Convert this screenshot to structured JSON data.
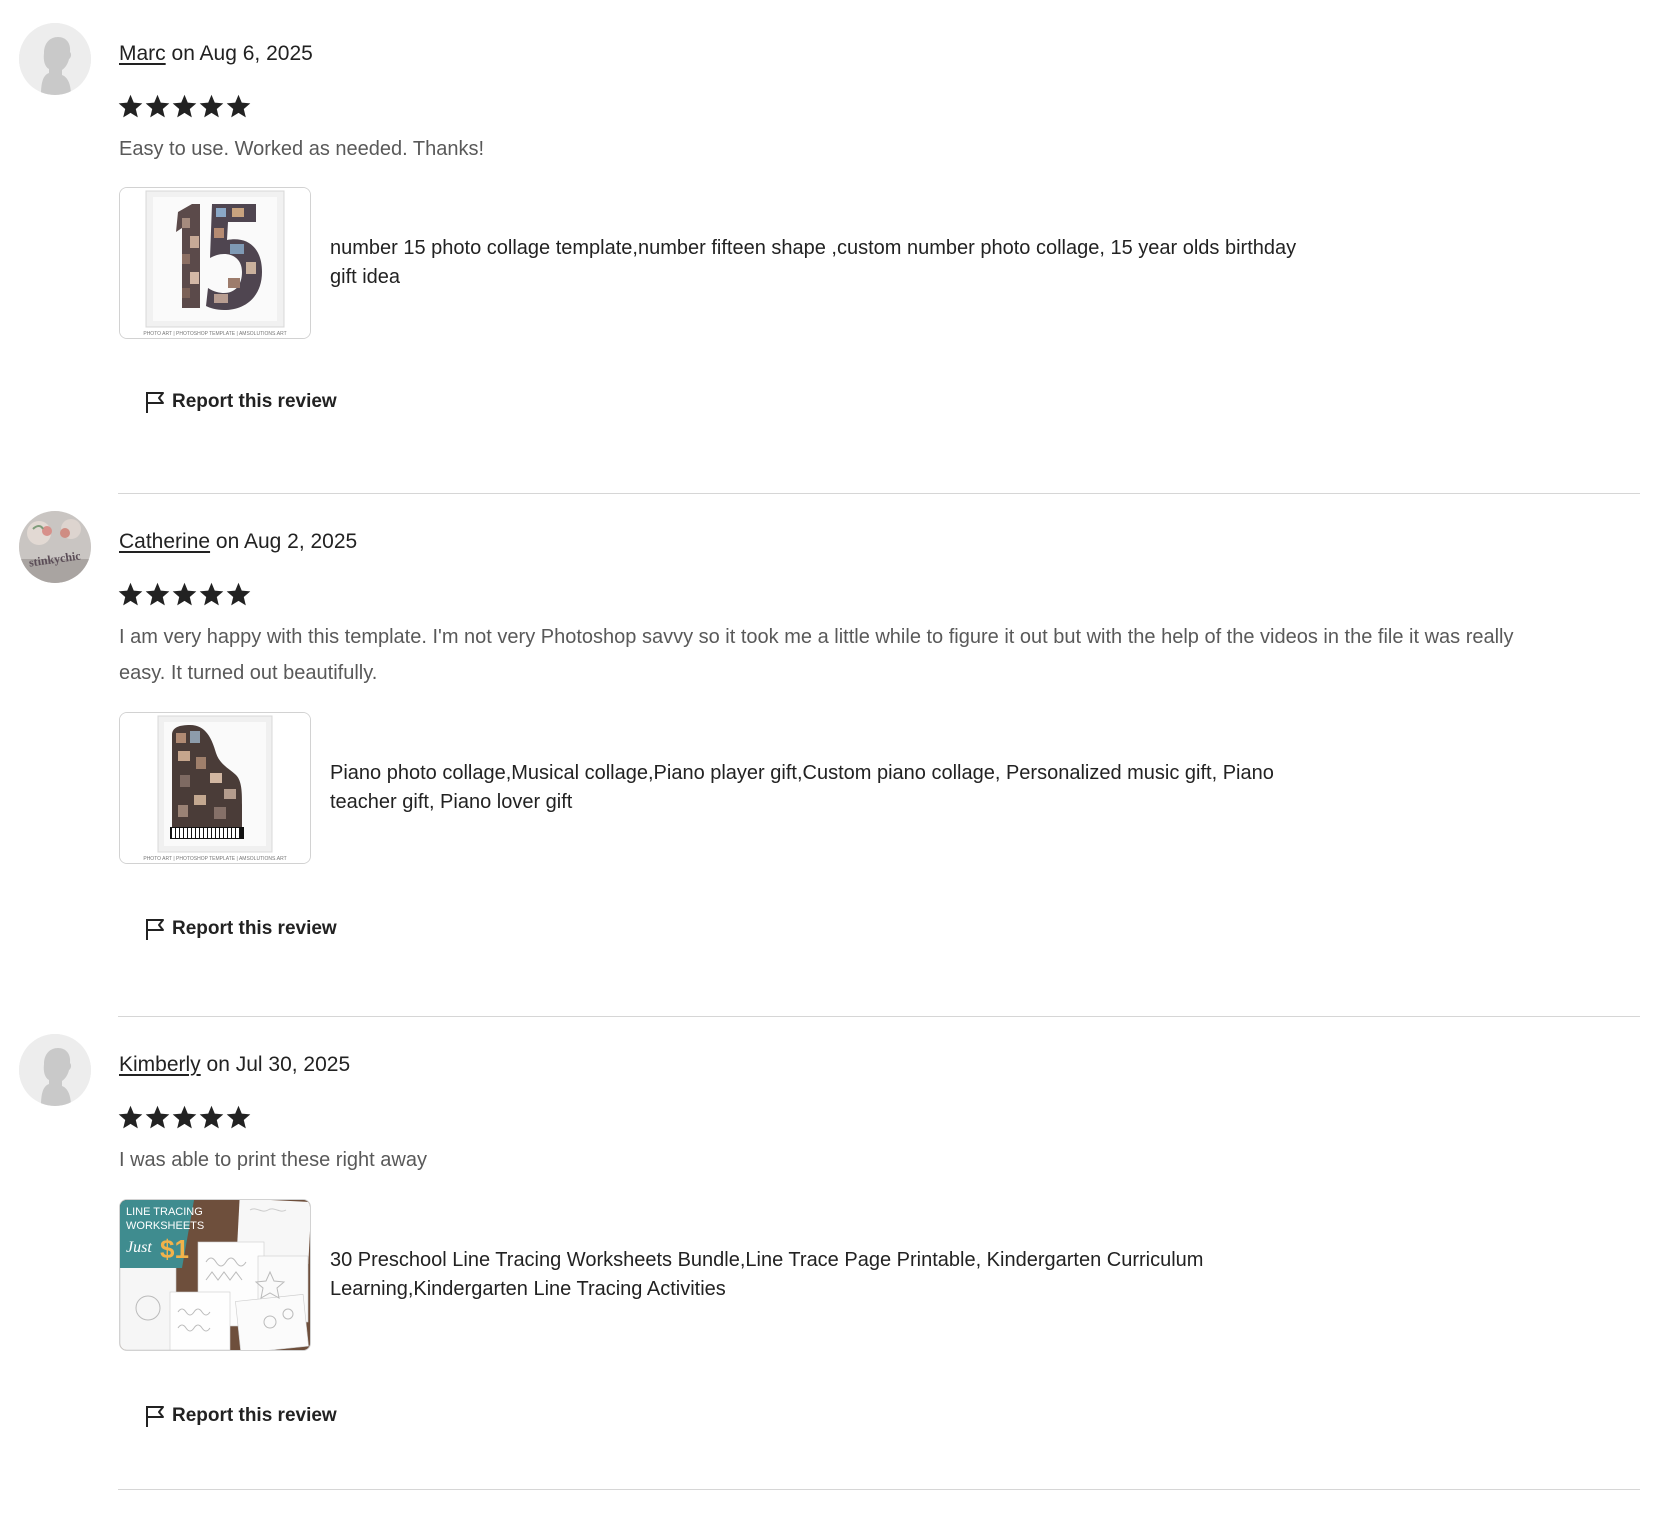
{
  "reviews": [
    {
      "author": "Marc",
      "date_text": "on Aug 6, 2025",
      "rating": 5,
      "text": "Easy to use. Worked as needed. Thanks!",
      "avatar_icon": "default-user-silhouette-icon",
      "product": {
        "title": "number 15 photo collage template,number fifteen shape ,custom number photo collage, 15 year olds birthday gift idea",
        "thumb_caption": "PHOTO ART | PHOTOSHOP TEMPLATE | AMSOLUTIONS.ART"
      },
      "report_label": "Report this review"
    },
    {
      "author": "Catherine",
      "date_text": "on Aug 2, 2025",
      "rating": 5,
      "text": "I am very happy with this template. I'm not very Photoshop savvy so it took me a little while to figure it out but with the help of the videos in the file it was really easy. It turned out beautifully.",
      "avatar_icon": "profile-photo-icon",
      "avatar_text": "stinkychic",
      "product": {
        "title": "Piano photo collage,Musical collage,Piano player gift,Custom piano collage, Personalized music gift, Piano teacher gift, Piano lover gift",
        "thumb_caption": "PHOTO ART | PHOTOSHOP TEMPLATE | AMSOLUTIONS.ART"
      },
      "report_label": "Report this review"
    },
    {
      "author": "Kimberly",
      "date_text": "on Jul 30, 2025",
      "rating": 5,
      "text": "I was able to print these right away",
      "avatar_icon": "default-user-silhouette-icon",
      "product": {
        "title": "30 Preschool Line Tracing Worksheets Bundle,Line Trace Page Printable, Kindergarten Curriculum Learning,Kindergarten Line Tracing Activities",
        "thumb_line1": "LINE TRACING",
        "thumb_line2": "WORKSHEETS",
        "thumb_line3": "Just",
        "thumb_price": "$1"
      },
      "report_label": "Report this review"
    }
  ],
  "colors": {
    "text": "#222222",
    "review_text": "#595959",
    "divider": "#d6d6d6",
    "star": "#222222",
    "thumb_teal": "#3f8c8f",
    "thumb_price": "#f2b24a"
  }
}
